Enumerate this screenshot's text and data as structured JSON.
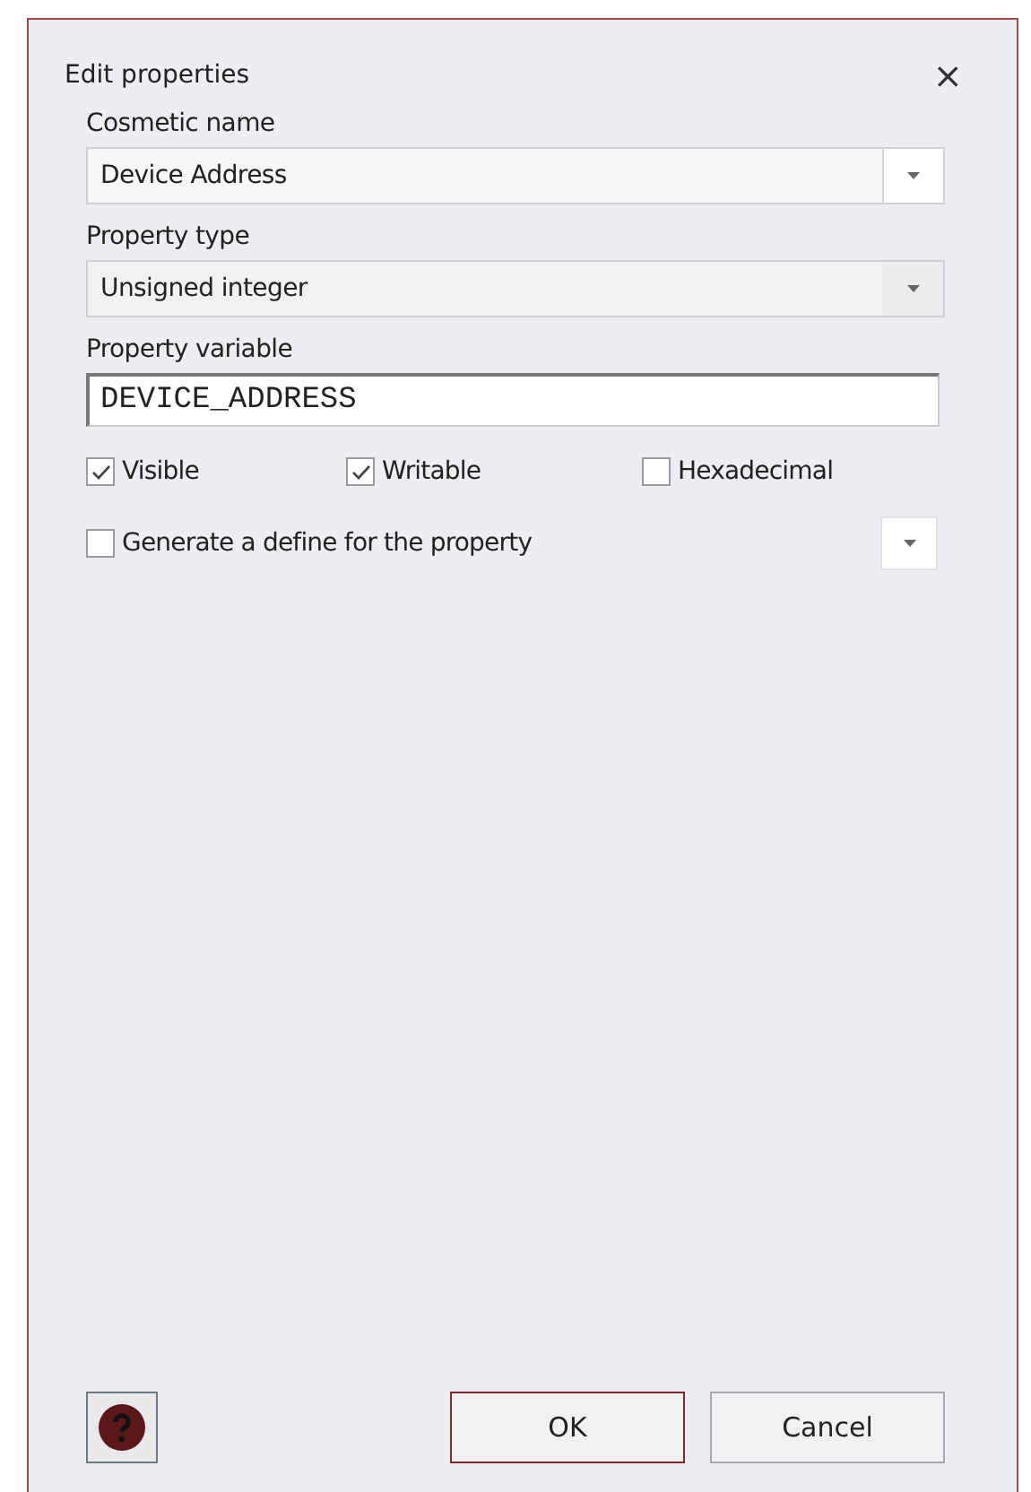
{
  "window": {
    "title": "Edit properties",
    "close": "×"
  },
  "fields": [
    {
      "kind": "combo",
      "label": "Cosmetic name",
      "value": "Device Address",
      "editable": true
    },
    {
      "kind": "combo",
      "label": "Property type",
      "value": "Unsigned integer",
      "editable": false
    },
    {
      "kind": "text",
      "label": "Property variable",
      "value": "DEVICE_ADDRESS"
    }
  ],
  "options": [
    {
      "label": "Visible",
      "checked": true
    },
    {
      "label": "Writable",
      "checked": true
    },
    {
      "label": "Hexadecimal",
      "checked": false
    }
  ],
  "define": {
    "label": "Generate a define for the property",
    "checked": false
  },
  "buttons": [
    {
      "label": "OK",
      "default": true
    },
    {
      "label": "Cancel",
      "default": false
    }
  ]
}
